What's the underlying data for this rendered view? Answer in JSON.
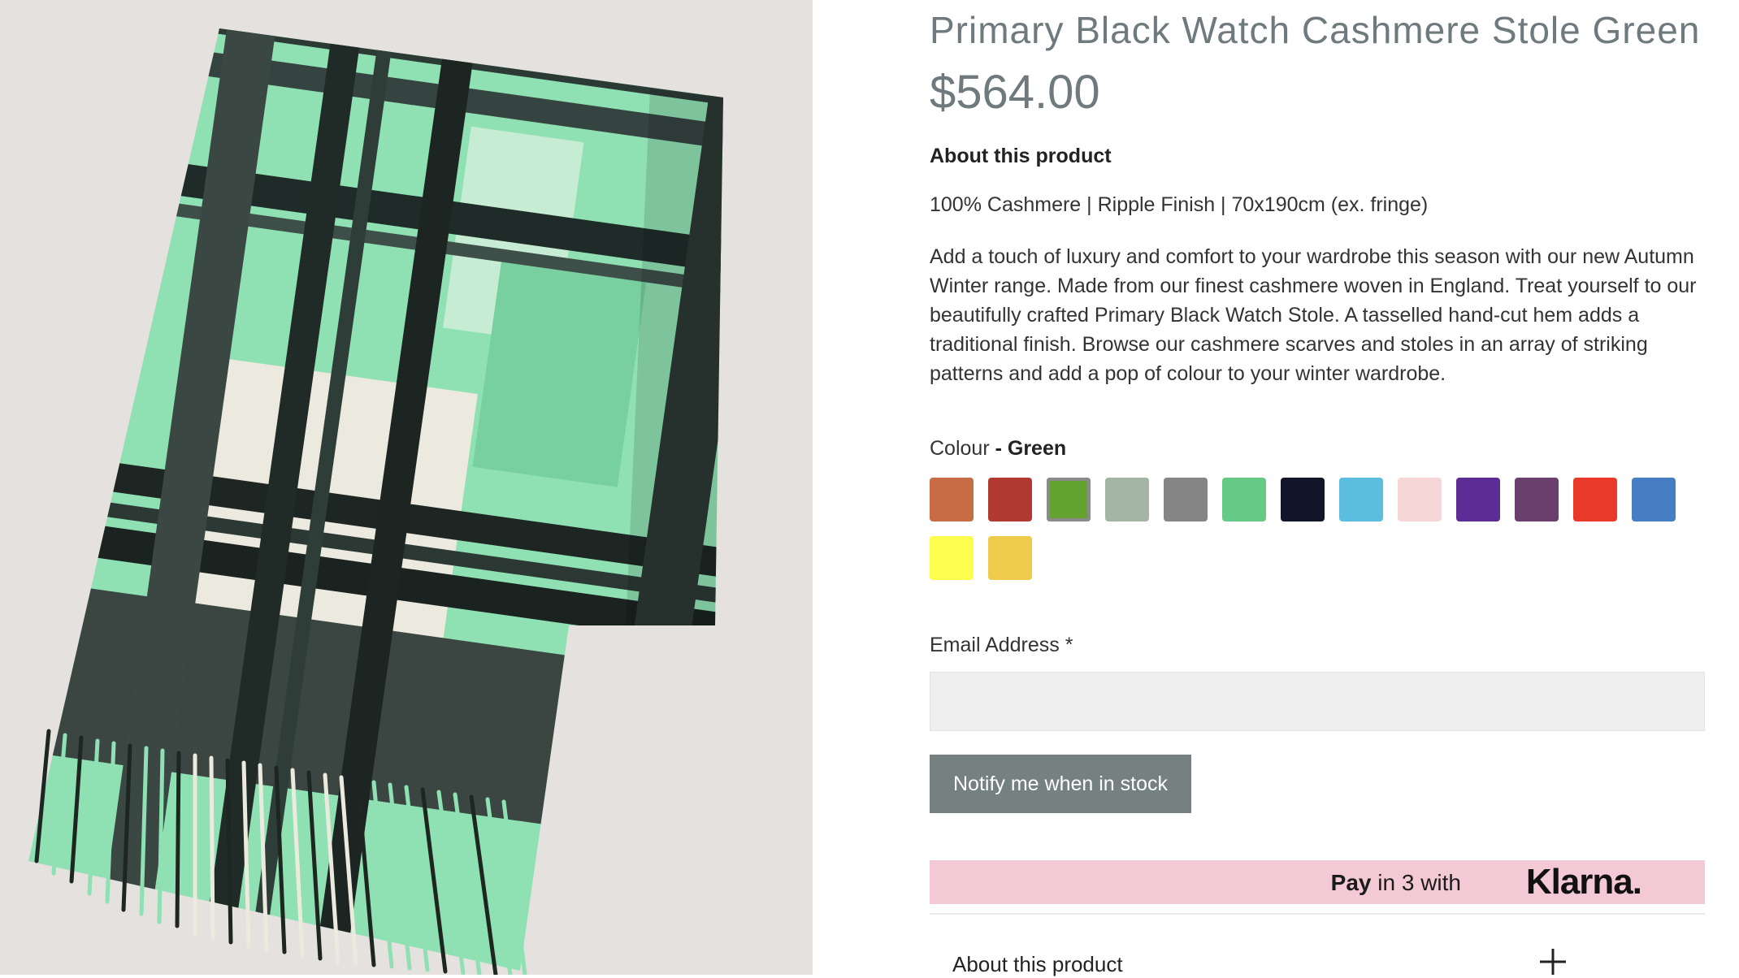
{
  "product": {
    "title": "Primary Black Watch Cashmere Stole Green",
    "price": "$564.00",
    "about_heading": "About this product",
    "spec": "100% Cashmere | Ripple Finish | 70x190cm (ex. fringe)",
    "description": "Add a touch of luxury and comfort to your wardrobe this season with our new Autumn Winter range. Made from our finest cashmere woven in England. Treat yourself to our beautifully crafted Primary Black Watch Stole. A tasselled hand-cut hem adds a traditional finish. Browse our cashmere scarves and stoles in an array of striking patterns and add a pop of colour to your winter wardrobe."
  },
  "colour": {
    "label": "Colour",
    "selected_prefix": " - ",
    "selected": "Green",
    "swatches": [
      "#c86c45",
      "#b03a32",
      "#63a22f",
      "#a4b5a4",
      "#858585",
      "#66c985",
      "#121629",
      "#5bbddf",
      "#f7d6d7",
      "#5d2d95",
      "#6a3f6d",
      "#e8392a",
      "#477ec3",
      "#fdfd4e",
      "#eecb4a"
    ],
    "selected_index": 2
  },
  "form": {
    "email_label": "Email Address",
    "required_mark": "*",
    "email_value": "",
    "notify_label": "Notify me when in stock"
  },
  "klarna": {
    "pay": "Pay",
    "text": " in 3 with",
    "logo": "Klarna."
  },
  "accordion": {
    "label": "About this product"
  }
}
